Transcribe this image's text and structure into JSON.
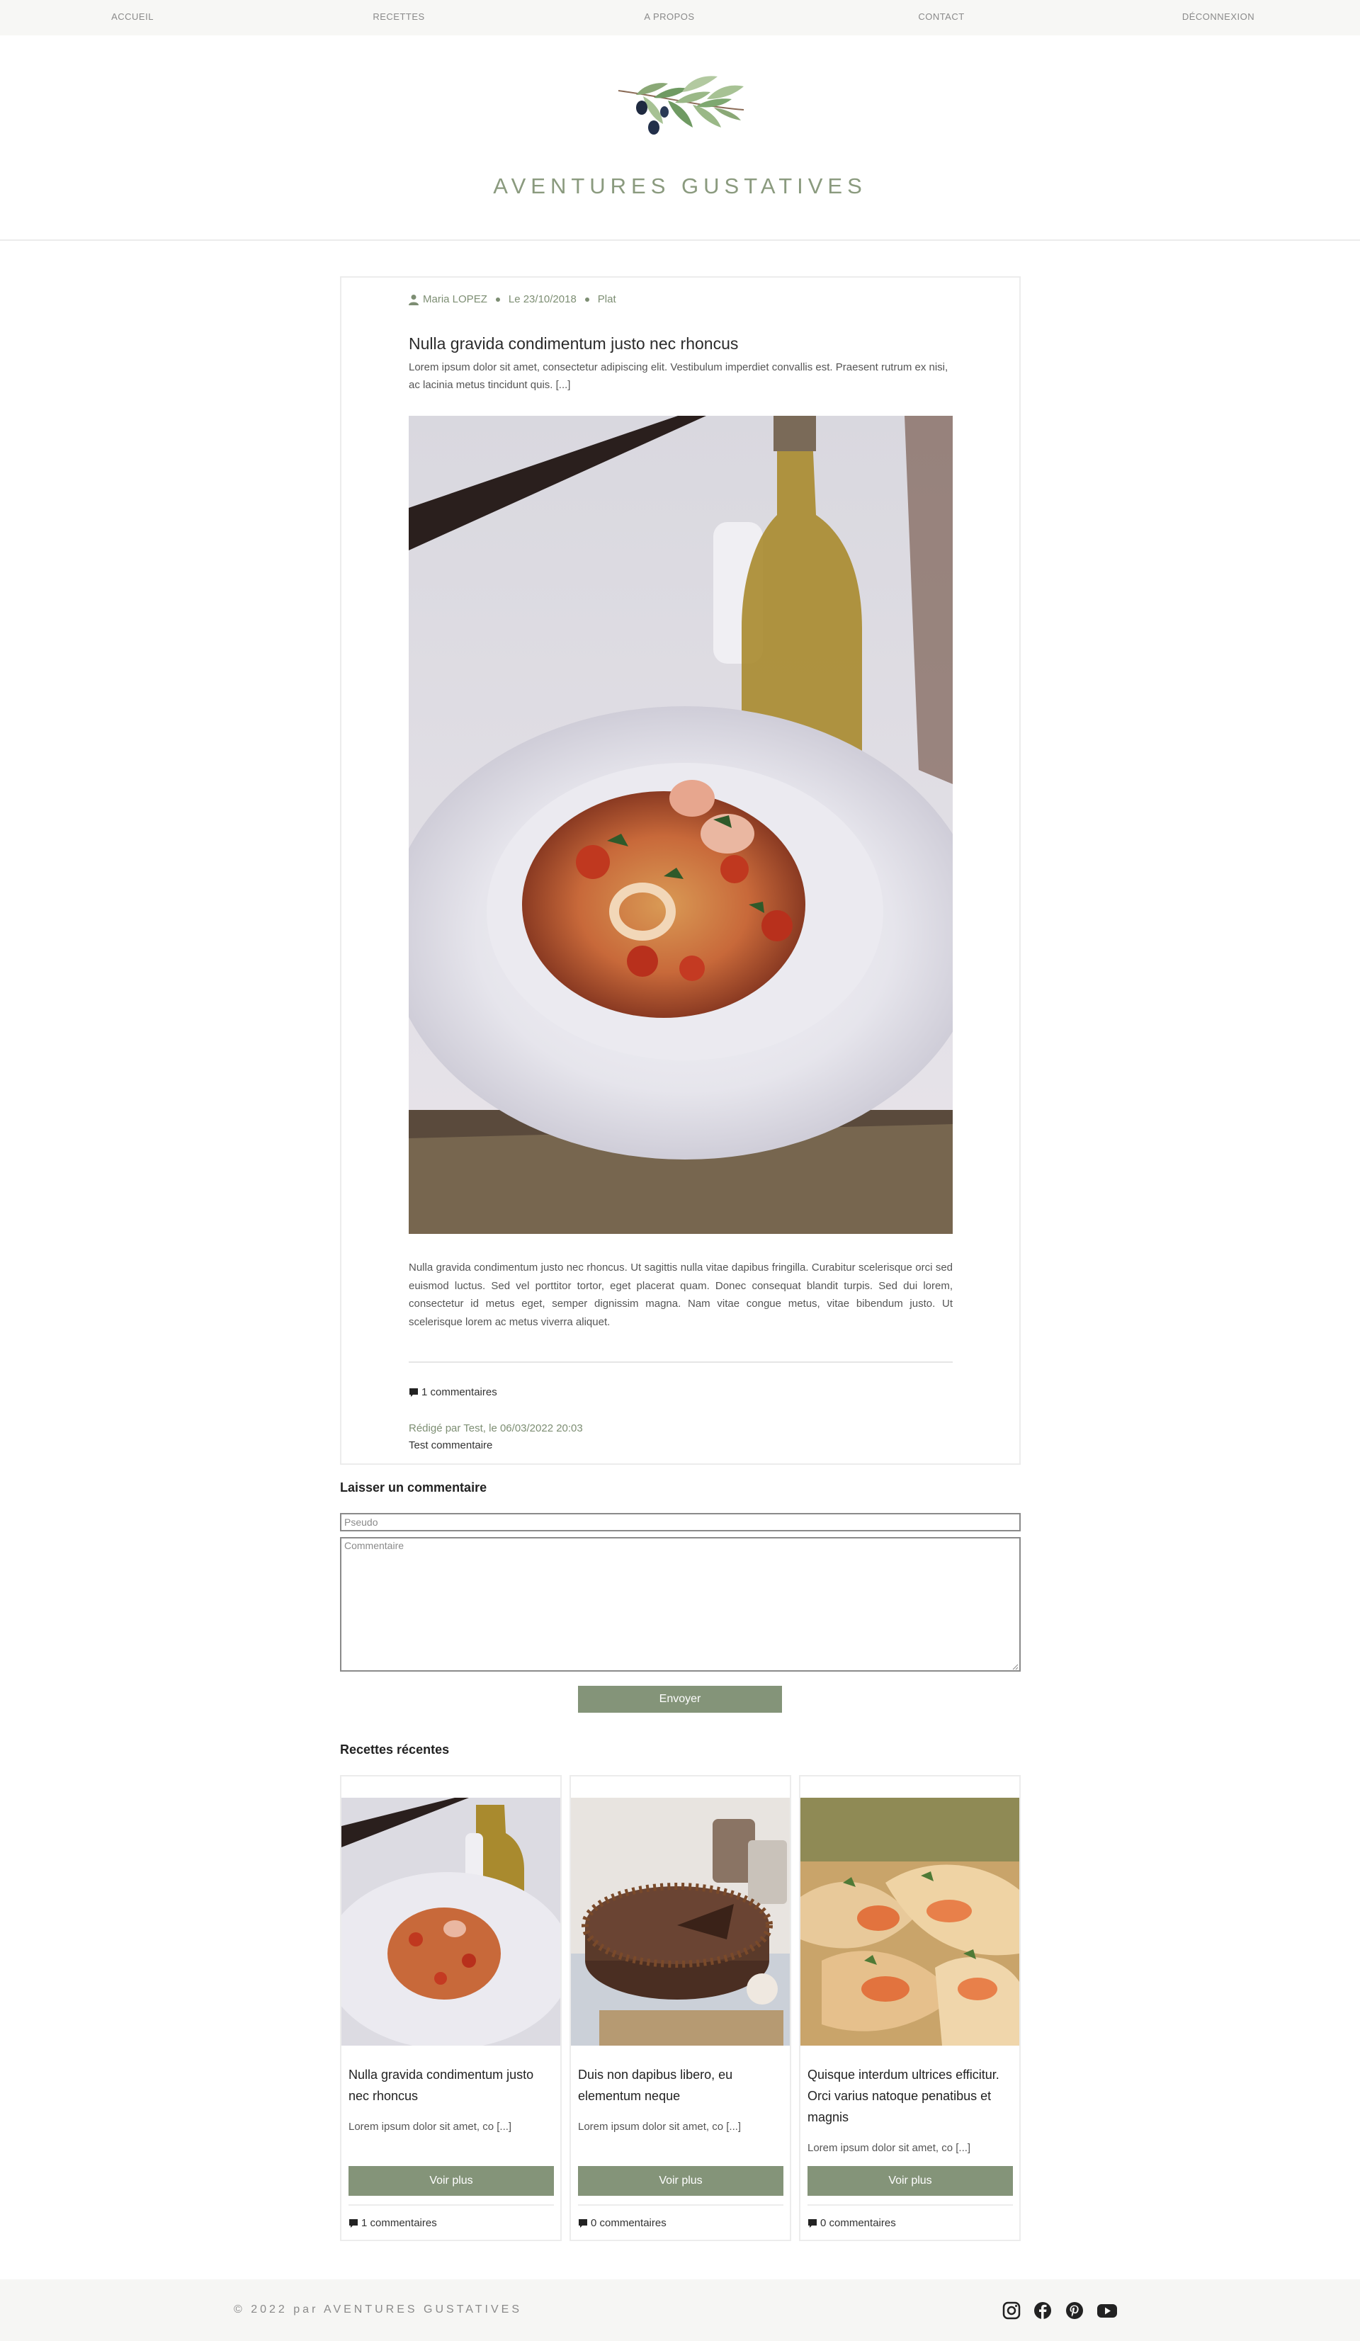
{
  "nav": {
    "items": [
      "ACCUEIL",
      "RECETTES",
      "A PROPOS",
      "CONTACT",
      "DÉCONNEXION"
    ]
  },
  "header": {
    "site_title": "AVENTURES GUSTATIVES",
    "logo_icon": "olive-branch-icon"
  },
  "article": {
    "author": "Maria LOPEZ",
    "date": "Le 23/10/2018",
    "category": "Plat",
    "title": "Nulla gravida condimentum justo nec rhoncus",
    "excerpt": "Lorem ipsum dolor sit amet, consectetur adipiscing elit. Vestibulum imperdiet convallis est. Praesent rutrum ex nisi, ac lacinia metus tincidunt quis. [...]",
    "body": "Nulla gravida condimentum justo nec rhoncus. Ut sagittis nulla vitae dapibus fringilla. Curabitur scelerisque orci sed euismod luctus. Sed vel porttitor tortor, eget placerat quam. Donec consequat blandit turpis. Sed dui lorem, consectetur id metus eget, semper dignissim magna. Nam vitae congue metus, vitae bibendum justo. Ut scelerisque lorem ac metus viverra aliquet.",
    "comments_count": "1 commentaires",
    "comments": [
      {
        "meta": "Rédigé par Test, le 06/03/2022 20:03",
        "text": "Test commentaire"
      }
    ]
  },
  "comment_form": {
    "heading": "Laisser un commentaire",
    "pseudo_placeholder": "Pseudo",
    "comment_placeholder": "Commentaire",
    "submit_label": "Envoyer"
  },
  "recent": {
    "heading": "Recettes récentes",
    "cards": [
      {
        "title": "Nulla gravida condimentum justo nec rhoncus",
        "excerpt": "Lorem ipsum dolor sit amet, co [...]",
        "button": "Voir plus",
        "comments": "1 commentaires"
      },
      {
        "title": "Duis non dapibus libero, eu elementum neque",
        "excerpt": "Lorem ipsum dolor sit amet, co [...]",
        "button": "Voir plus",
        "comments": "0 commentaires"
      },
      {
        "title": "Quisque interdum ultrices efficitur. Orci varius natoque penatibus et magnis",
        "excerpt": "Lorem ipsum dolor sit amet, co [...]",
        "button": "Voir plus",
        "comments": "0 commentaires"
      }
    ]
  },
  "footer": {
    "copyright": "© 2022 par AVENTURES GUSTATIVES",
    "social_icons": [
      "instagram-icon",
      "facebook-icon",
      "pinterest-icon",
      "youtube-icon"
    ]
  },
  "colors": {
    "accent": "#849479",
    "meta_text": "#7d8e73",
    "title_green": "#8a9a7e",
    "nav_bg": "#f7f7f5"
  }
}
